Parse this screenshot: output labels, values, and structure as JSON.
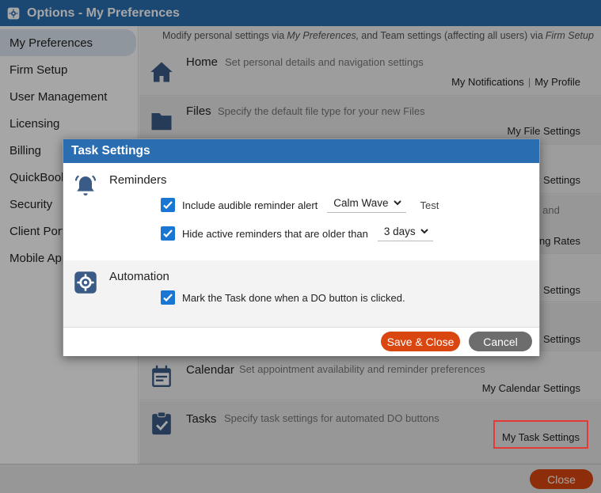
{
  "window": {
    "title": "Options - My Preferences"
  },
  "sidebar": {
    "items": [
      {
        "label": "My Preferences",
        "active": true
      },
      {
        "label": "Firm Setup"
      },
      {
        "label": "User Management"
      },
      {
        "label": "Licensing"
      },
      {
        "label": "Billing"
      },
      {
        "label": "QuickBooks"
      },
      {
        "label": "Security"
      },
      {
        "label": "Client Portal"
      },
      {
        "label": "Mobile App"
      }
    ]
  },
  "main": {
    "hint_prefix": "Modify personal settings via",
    "hint_link1": "My Preferences,",
    "hint_mid": "and Team settings (affecting all users) via",
    "hint_link2": "Firm Setup",
    "rows": [
      {
        "title": "Home",
        "desc": "Set personal details and navigation settings",
        "link1": "My Notifications",
        "link2": "My Profile",
        "icon": "home-icon"
      },
      {
        "title": "Files",
        "desc": "Specify the default file type for your new Files",
        "link1": "My File Settings",
        "icon": "folder-icon"
      },
      {
        "link1": "t Settings"
      },
      {
        "desc": "s and",
        "link1": "ing Rates"
      },
      {
        "link1": "e Settings"
      },
      {
        "link1": "Settings"
      },
      {
        "title": "Calendar",
        "desc": "Set appointment availability and reminder preferences",
        "link1": "My Calendar Settings",
        "icon": "calendar-icon"
      },
      {
        "title": "Tasks",
        "desc": "Specify task settings for automated DO buttons",
        "link1": "My Task Settings",
        "icon": "clipboard-check-icon"
      }
    ]
  },
  "footer": {
    "close_label": "Close"
  },
  "dialog": {
    "title": "Task Settings",
    "reminders": {
      "title": "Reminders",
      "icon": "bell-icon",
      "audible_label": "Include audible reminder alert",
      "audible_checked": true,
      "sound_value": "Calm Wave",
      "test_label": "Test",
      "hide_label": "Hide active reminders that are older than",
      "hide_checked": true,
      "age_value": "3 days"
    },
    "automation": {
      "title": "Automation",
      "icon": "gear-icon",
      "done_label": "Mark the Task done when a DO button is clicked.",
      "done_checked": true
    },
    "save_label": "Save & Close",
    "cancel_label": "Cancel"
  },
  "colors": {
    "accent": "#2a6db1",
    "primary_button": "#d9460f",
    "secondary_button": "#6d6d6d",
    "checkbox": "#1976d2",
    "highlight": "#e53935"
  }
}
